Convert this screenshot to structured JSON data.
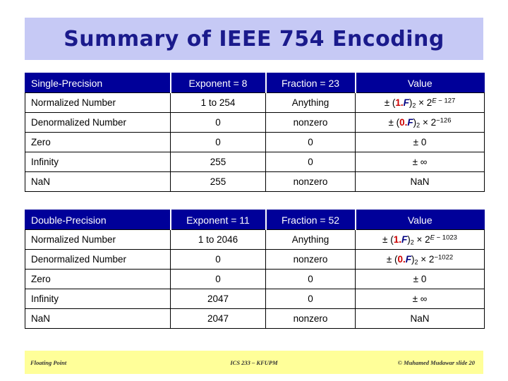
{
  "slide": {
    "title": "Summary of IEEE 754 Encoding"
  },
  "tables": [
    {
      "id": "single",
      "headers": {
        "label": "Single-Precision",
        "exponent": "Exponent = 8",
        "fraction": "Fraction = 23",
        "value": "Value"
      },
      "rows": [
        {
          "label": "Normalized Number",
          "exponent": "1 to 254",
          "fraction": "Anything",
          "value": {
            "text": "± (1.F)2 × 2E − 127",
            "sign": "±",
            "open": "(",
            "lead": "1.",
            "fvar": "F",
            "close": ")",
            "base_sub": "2",
            "times": "×",
            "base": "2",
            "exp_var": "E",
            "exp_rest": " − 127"
          }
        },
        {
          "label": "Denormalized Number",
          "exponent": "0",
          "fraction": "nonzero",
          "value": {
            "text": "± (0.F)2 × 2−126",
            "sign": "±",
            "open": "(",
            "lead": "0.",
            "fvar": "F",
            "close": ")",
            "base_sub": "2",
            "times": "×",
            "base": "2",
            "exp_var": "",
            "exp_rest": "−126"
          }
        },
        {
          "label": "Zero",
          "exponent": "0",
          "fraction": "0",
          "value": {
            "text": "± 0",
            "plain": "± 0"
          }
        },
        {
          "label": "Infinity",
          "exponent": "255",
          "fraction": "0",
          "value": {
            "text": "± ∞",
            "plain": "± ∞"
          }
        },
        {
          "label": "NaN",
          "exponent": "255",
          "fraction": "nonzero",
          "value": {
            "text": "NaN",
            "plain": "NaN"
          }
        }
      ]
    },
    {
      "id": "double",
      "headers": {
        "label": "Double-Precision",
        "exponent": "Exponent = 11",
        "fraction": "Fraction = 52",
        "value": "Value"
      },
      "rows": [
        {
          "label": "Normalized Number",
          "exponent": "1 to 2046",
          "fraction": "Anything",
          "value": {
            "text": "± (1.F)2 × 2E − 1023",
            "sign": "±",
            "open": "(",
            "lead": "1.",
            "fvar": "F",
            "close": ")",
            "base_sub": "2",
            "times": "×",
            "base": "2",
            "exp_var": "E",
            "exp_rest": " − 1023"
          }
        },
        {
          "label": "Denormalized Number",
          "exponent": "0",
          "fraction": "nonzero",
          "value": {
            "text": "± (0.F)2 × 2−1022",
            "sign": "±",
            "open": "(",
            "lead": "0.",
            "fvar": "F",
            "close": ")",
            "base_sub": "2",
            "times": "×",
            "base": "2",
            "exp_var": "",
            "exp_rest": "−1022"
          }
        },
        {
          "label": "Zero",
          "exponent": "0",
          "fraction": "0",
          "value": {
            "text": "± 0",
            "plain": "± 0"
          }
        },
        {
          "label": "Infinity",
          "exponent": "2047",
          "fraction": "0",
          "value": {
            "text": "± ∞",
            "plain": "± ∞"
          }
        },
        {
          "label": "NaN",
          "exponent": "2047",
          "fraction": "nonzero",
          "value": {
            "text": "NaN",
            "plain": "NaN"
          }
        }
      ]
    }
  ],
  "footer": {
    "left": "Floating Point",
    "center": "ICS 233 – KFUPM",
    "right": "© Muhamed Mudawar  slide 20"
  },
  "colors": {
    "title_banner_bg": "#c6c9f5",
    "title_text": "#1a1a8c",
    "header_row_bg": "#000099",
    "header_row_text": "#ffffff",
    "lead_digit": "#cc0000",
    "fraction_var": "#000080",
    "footer_bg": "#ffff99",
    "page_bg": "#ffffff"
  }
}
